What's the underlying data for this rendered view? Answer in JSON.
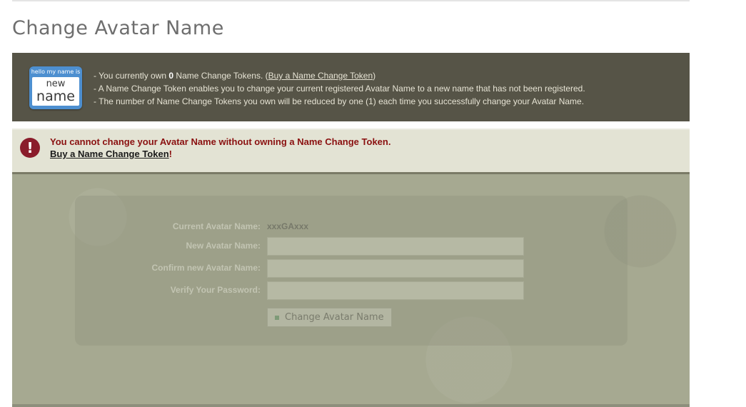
{
  "page": {
    "title": "Change Avatar Name"
  },
  "info": {
    "badge_top": "hello my name is",
    "badge_line1": "new",
    "badge_line2": "name",
    "line1_prefix": "- You currently own ",
    "token_count": "0",
    "line1_middle": " Name Change Tokens. (",
    "buy_link": "Buy a Name Change Token",
    "line1_suffix": ")",
    "line2": "- A Name Change Token enables you to change your current registered Avatar Name to a new name that has not been registered.",
    "line3": "- The number of Name Change Tokens you own will be reduced by one (1) each time you successfully change your Avatar Name."
  },
  "alert": {
    "icon_glyph": "!",
    "message": "You cannot change your Avatar Name without owning a Name Change Token.",
    "link": "Buy a Name Change Token",
    "link_suffix": "!"
  },
  "form": {
    "current_label": "Current Avatar Name:",
    "current_value": "xxxGAxxx",
    "new_label": "New Avatar Name:",
    "new_value": "",
    "confirm_label": "Confirm new Avatar Name:",
    "confirm_value": "",
    "password_label": "Verify Your Password:",
    "password_value": "",
    "submit_label": "Change Avatar Name"
  },
  "colors": {
    "info_panel_bg": "#565447",
    "alert_text": "#8a1010",
    "form_bg": "#a6a991",
    "badge_blue": "#4d8fd0"
  }
}
